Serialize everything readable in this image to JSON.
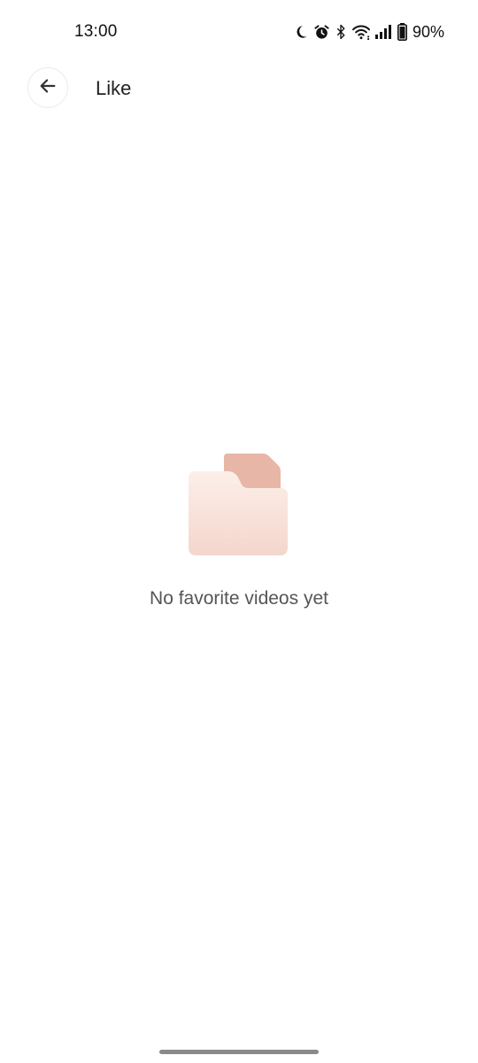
{
  "status_bar": {
    "time": "13:00",
    "battery_percent": "90%",
    "icons": [
      "moon-icon",
      "alarm-icon",
      "bluetooth-icon",
      "wifi-icon",
      "signal-icon",
      "battery-icon"
    ]
  },
  "app_bar": {
    "back_icon": "arrow-left-icon",
    "title": "Like"
  },
  "empty_state": {
    "icon": "folder-icon",
    "message": "No favorite videos yet"
  },
  "colors": {
    "folder_back": "#e8b6a7",
    "folder_front_top": "#fcefe9",
    "folder_front_bottom": "#f4d6cc",
    "text_secondary": "#555555"
  }
}
